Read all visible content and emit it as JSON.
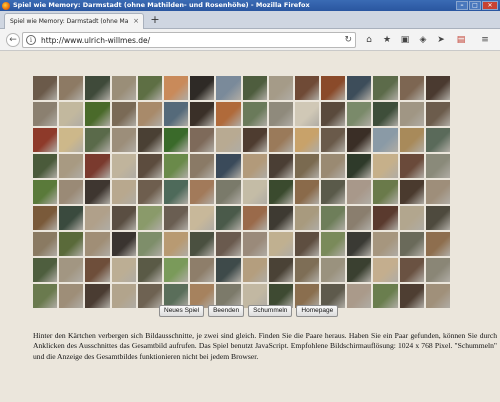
{
  "window": {
    "title": "Spiel wie Memory: Darmstadt (ohne Mathilden- und Rosenhöhe) - Mozilla Firefox",
    "buttons": {
      "minimize": "–",
      "maximize": "□",
      "close": "✕"
    }
  },
  "tabs": [
    {
      "label": "Spiel wie Memory: Darmstadt (ohne Mathilden",
      "close": "×"
    }
  ],
  "new_tab_label": "+",
  "navbar": {
    "back": "←",
    "url": "http://www.ulrich-willmes.de/",
    "reload": "↻",
    "icons": [
      "home-icon",
      "star-icon",
      "clipboard-icon",
      "pocket-icon",
      "send-icon",
      "pdf-icon",
      "menu-icon"
    ]
  },
  "game": {
    "rows": 9,
    "cols": 16,
    "tile_colors": [
      "#6b5a4a",
      "#8d7a64",
      "#3f4a3a",
      "#9a8e78",
      "#5e6f44",
      "#c98a5a",
      "#2e2a26",
      "#7a8a9a",
      "#4e5d3e",
      "#a59b88",
      "#6f4a36",
      "#8a4a2a",
      "#3d4d5a",
      "#5c6b4a",
      "#7d6652",
      "#4a3a30",
      "#8b8070",
      "#c2b89e",
      "#4a6a2a",
      "#7a6a56",
      "#a88a6a",
      "#556a7a",
      "#3a3028",
      "#b06a3a",
      "#6a7a5a",
      "#8f8a7c",
      "#d0c8b6",
      "#5a4a3c",
      "#7a8a6a",
      "#3e4e3a",
      "#a09684",
      "#6c5c4c",
      "#8e3a2a",
      "#cdb88a",
      "#5a6a4a",
      "#9c8e7a",
      "#4a4034",
      "#3a6a2a",
      "#7e6a5a",
      "#b8aa92",
      "#4e3c30",
      "#9a7a5a",
      "#c8a26a",
      "#6a5a4a",
      "#3a2e26",
      "#8a9aa6",
      "#a88a5a",
      "#5a6a5a",
      "#4a5a3a",
      "#a89a82",
      "#7a3a2e",
      "#c0b49c",
      "#5c4c3e",
      "#6a8a4a",
      "#8a7a66",
      "#3a4a5a",
      "#b29a7a",
      "#4a3e34",
      "#7a6a50",
      "#9a8a72",
      "#2e3a2a",
      "#c6b08a",
      "#6a4a3a",
      "#8a8a7a",
      "#5a7a3a",
      "#9a8a76",
      "#3e3630",
      "#b8a88e",
      "#6e5e4e",
      "#4e6a5a",
      "#a27a5a",
      "#7a7a6a",
      "#c4bca6",
      "#3a4a2e",
      "#8a6a4a",
      "#5a5a4a",
      "#a8988a",
      "#6a7a4a",
      "#4a3a2e",
      "#9e8e7a",
      "#7a5a3a",
      "#3a4a3e",
      "#b0a08a",
      "#5a4e42",
      "#8a9a6a",
      "#6a5e52",
      "#c8b89a",
      "#4a5a4a",
      "#9a6a4a",
      "#3e3a32",
      "#a89a7e",
      "#6e7e5a",
      "#8a7e6e",
      "#5a3a2e",
      "#b2a68e",
      "#4e4a3e",
      "#8a7a62",
      "#5a6a3a",
      "#a08e76",
      "#3a3430",
      "#7e8e6a",
      "#b89a72",
      "#4a5040",
      "#6a5a4e",
      "#9a8a7a",
      "#c0b090",
      "#5e4e40",
      "#7a8a5a",
      "#3a3a34",
      "#a6967e",
      "#6a6a5a",
      "#8e6e4e",
      "#4e5e3e",
      "#a29682",
      "#6e4e3a",
      "#bcae94",
      "#5a5a46",
      "#7a9a5a",
      "#8e7e6a",
      "#3e4a4a",
      "#b49e7e",
      "#4a4236",
      "#7e6e56",
      "#9a927e",
      "#3a4030",
      "#c4ae8e",
      "#6a5242",
      "#8a8676",
      "#6a7a4e",
      "#9e8e78",
      "#4a3c32",
      "#b2a48c",
      "#6e6252",
      "#5a6e5a",
      "#a6825e",
      "#7c7a6a",
      "#c2b8a2",
      "#3e4a32",
      "#8a6e4e",
      "#5e5a4c",
      "#aa9a8a",
      "#6a7e4e",
      "#4e3e32",
      "#a0907a"
    ]
  },
  "controls": {
    "new_game": "Neues Spiel",
    "end": "Beenden",
    "cheat": "Schummeln",
    "homepage": "Homepage"
  },
  "description": "Hinter den Kärtchen verbergen sich Bildausschnitte, je zwei sind gleich. Finden Sie die Paare heraus. Haben Sie ein Paar gefunden, können Sie durch Anklicken des Ausschnittes das Gesamtbild aufrufen. Das Spiel benutzt JavaScript. Empfohlene Bildschirmauflösung: 1024 x 768 Pixel. \"Schummeln\" und die Anzeige des Gesamtbildes funktionieren nicht bei jedem Browser."
}
